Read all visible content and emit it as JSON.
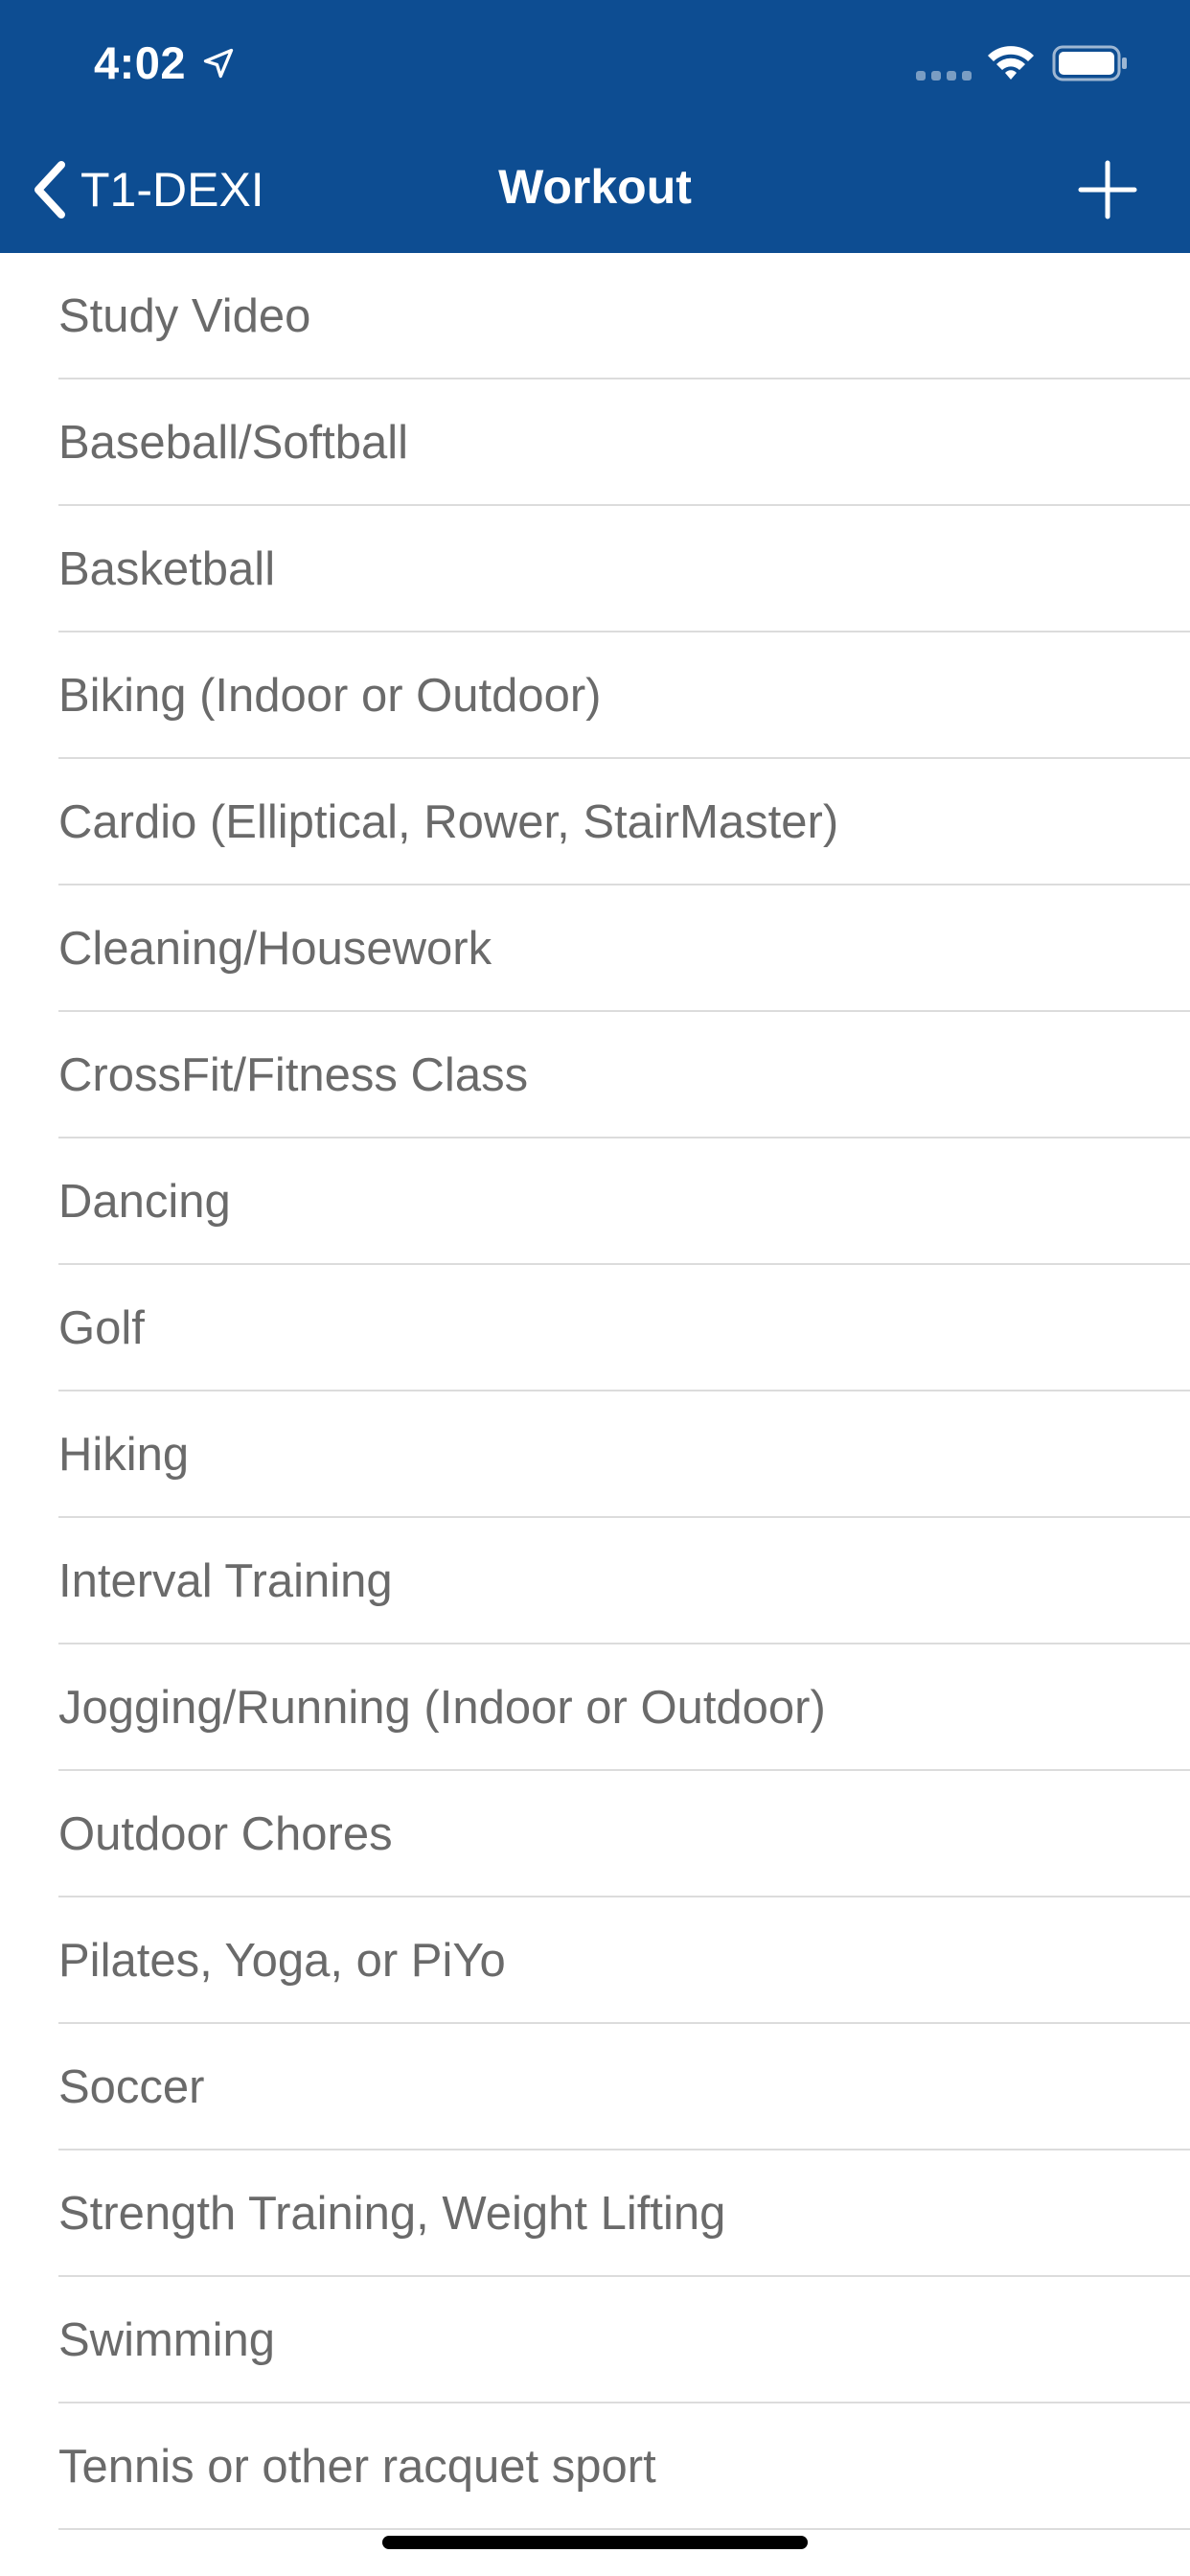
{
  "colors": {
    "header_background": "#0d4d92",
    "header_text": "#ffffff",
    "item_text": "#6a6a6a",
    "separator": "#dcdcdc"
  },
  "status_bar": {
    "time": "4:02",
    "icons": [
      "location-arrow-icon",
      "cellular-signal-icon",
      "wifi-icon",
      "battery-icon"
    ]
  },
  "nav_bar": {
    "back_label": "T1-DEXI",
    "title": "Workout",
    "back_icon": "chevron-left-icon",
    "add_icon": "plus-icon"
  },
  "workouts": [
    {
      "label": "Study Video"
    },
    {
      "label": "Baseball/Softball"
    },
    {
      "label": "Basketball"
    },
    {
      "label": "Biking (Indoor or Outdoor)"
    },
    {
      "label": "Cardio (Elliptical, Rower, StairMaster)"
    },
    {
      "label": "Cleaning/Housework"
    },
    {
      "label": "CrossFit/Fitness Class"
    },
    {
      "label": "Dancing"
    },
    {
      "label": "Golf"
    },
    {
      "label": "Hiking"
    },
    {
      "label": "Interval Training"
    },
    {
      "label": "Jogging/Running (Indoor or Outdoor)"
    },
    {
      "label": "Outdoor Chores"
    },
    {
      "label": "Pilates, Yoga, or PiYo"
    },
    {
      "label": "Soccer"
    },
    {
      "label": "Strength Training, Weight Lifting"
    },
    {
      "label": "Swimming"
    },
    {
      "label": "Tennis or other racquet sport"
    }
  ]
}
